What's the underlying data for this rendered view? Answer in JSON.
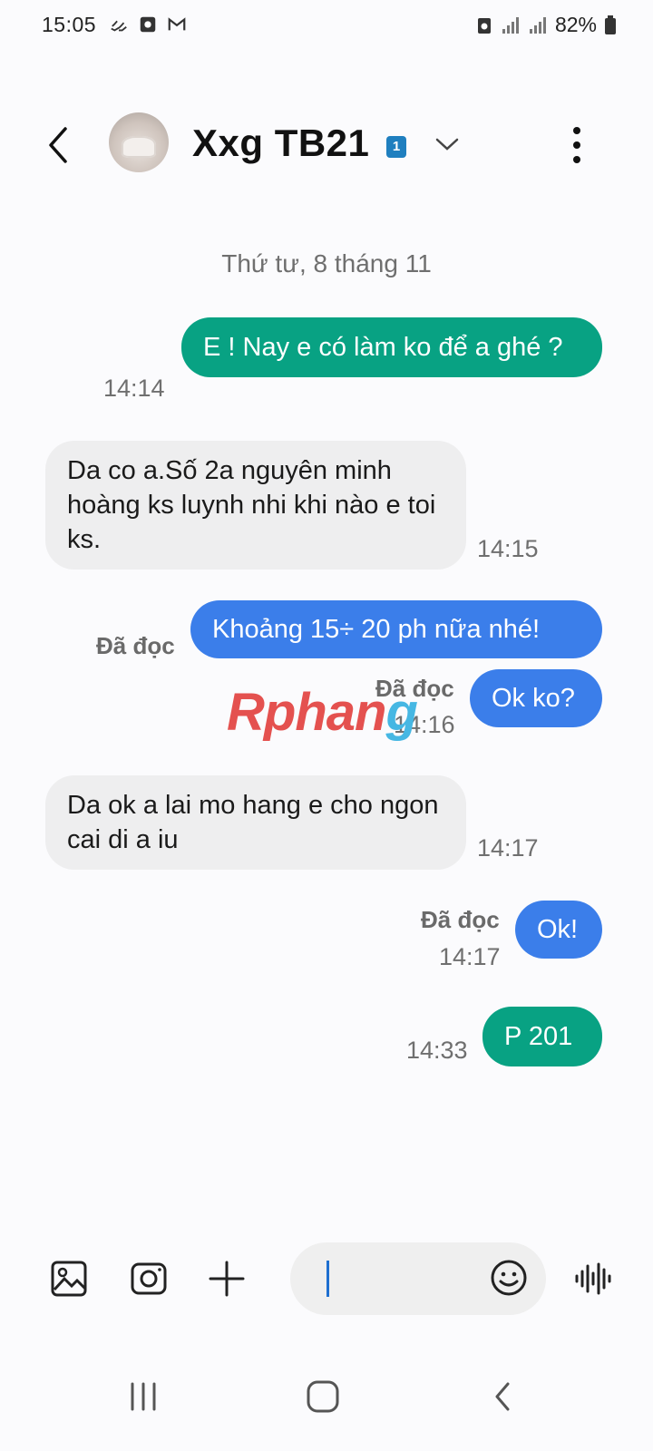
{
  "status_bar": {
    "time": "15:05",
    "battery": "82%",
    "icons": [
      "hands-icon",
      "camera-square-icon",
      "gmail-icon",
      "battery-saver-icon",
      "signal-icon",
      "signal-icon",
      "battery-icon"
    ]
  },
  "header": {
    "contact_name": "Xxg TB21",
    "sim_badge": "1"
  },
  "conversation": {
    "date_separator": "Thứ tư, 8 tháng 11",
    "messages": [
      {
        "direction": "out",
        "text": "E ! Nay e có làm ko để a ghé ?",
        "time": "14:14",
        "read": ""
      },
      {
        "direction": "in",
        "text": "Da co a.Số 2a nguyên minh hoàng ks luynh nhi khi nào e toi ks.",
        "time": "14:15"
      },
      {
        "direction": "out",
        "text": "Khoảng 15÷ 20 ph nữa nhé!",
        "time": "",
        "read": "Đã đọc"
      },
      {
        "direction": "out",
        "text": "Ok ko?",
        "time": "14:16",
        "read": "Đã đọc"
      },
      {
        "direction": "in",
        "text": "Da ok a lai mo hang e cho ngon cai di a iu",
        "time": "14:17"
      },
      {
        "direction": "out",
        "text": "Ok!",
        "time": "14:17",
        "read": "Đã đọc"
      },
      {
        "direction": "out",
        "text": "P 201",
        "time": "14:33",
        "read": ""
      }
    ]
  },
  "watermark": {
    "part1": "Rphan",
    "part2": "g"
  },
  "input": {
    "value": ""
  },
  "colors": {
    "outgoing_green": "#08a283",
    "outgoing_blue": "#3b7eea",
    "incoming_gray": "#eeeeef"
  }
}
